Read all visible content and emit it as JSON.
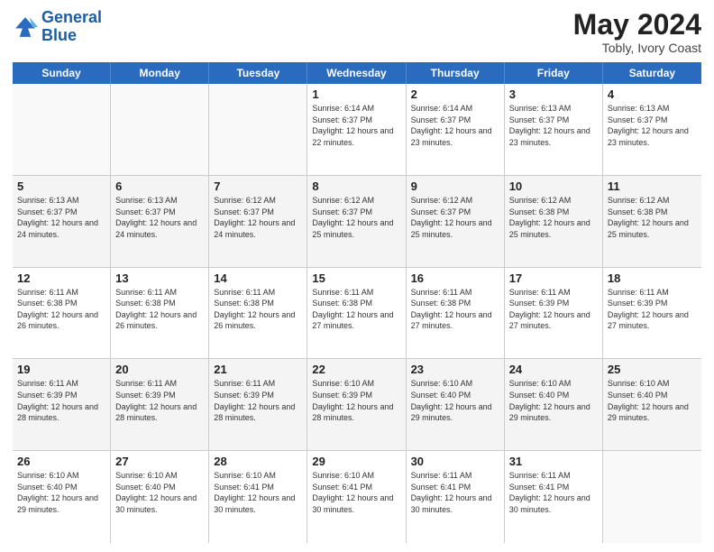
{
  "logo": {
    "text_general": "General",
    "text_blue": "Blue"
  },
  "header": {
    "month_year": "May 2024",
    "location": "Tobly, Ivory Coast"
  },
  "days_of_week": [
    "Sunday",
    "Monday",
    "Tuesday",
    "Wednesday",
    "Thursday",
    "Friday",
    "Saturday"
  ],
  "weeks": [
    [
      {
        "day": "",
        "sunrise": "",
        "sunset": "",
        "daylight": "",
        "empty": true
      },
      {
        "day": "",
        "sunrise": "",
        "sunset": "",
        "daylight": "",
        "empty": true
      },
      {
        "day": "",
        "sunrise": "",
        "sunset": "",
        "daylight": "",
        "empty": true
      },
      {
        "day": "1",
        "sunrise": "Sunrise: 6:14 AM",
        "sunset": "Sunset: 6:37 PM",
        "daylight": "Daylight: 12 hours and 22 minutes."
      },
      {
        "day": "2",
        "sunrise": "Sunrise: 6:14 AM",
        "sunset": "Sunset: 6:37 PM",
        "daylight": "Daylight: 12 hours and 23 minutes."
      },
      {
        "day": "3",
        "sunrise": "Sunrise: 6:13 AM",
        "sunset": "Sunset: 6:37 PM",
        "daylight": "Daylight: 12 hours and 23 minutes."
      },
      {
        "day": "4",
        "sunrise": "Sunrise: 6:13 AM",
        "sunset": "Sunset: 6:37 PM",
        "daylight": "Daylight: 12 hours and 23 minutes."
      }
    ],
    [
      {
        "day": "5",
        "sunrise": "Sunrise: 6:13 AM",
        "sunset": "Sunset: 6:37 PM",
        "daylight": "Daylight: 12 hours and 24 minutes."
      },
      {
        "day": "6",
        "sunrise": "Sunrise: 6:13 AM",
        "sunset": "Sunset: 6:37 PM",
        "daylight": "Daylight: 12 hours and 24 minutes."
      },
      {
        "day": "7",
        "sunrise": "Sunrise: 6:12 AM",
        "sunset": "Sunset: 6:37 PM",
        "daylight": "Daylight: 12 hours and 24 minutes."
      },
      {
        "day": "8",
        "sunrise": "Sunrise: 6:12 AM",
        "sunset": "Sunset: 6:37 PM",
        "daylight": "Daylight: 12 hours and 25 minutes."
      },
      {
        "day": "9",
        "sunrise": "Sunrise: 6:12 AM",
        "sunset": "Sunset: 6:37 PM",
        "daylight": "Daylight: 12 hours and 25 minutes."
      },
      {
        "day": "10",
        "sunrise": "Sunrise: 6:12 AM",
        "sunset": "Sunset: 6:38 PM",
        "daylight": "Daylight: 12 hours and 25 minutes."
      },
      {
        "day": "11",
        "sunrise": "Sunrise: 6:12 AM",
        "sunset": "Sunset: 6:38 PM",
        "daylight": "Daylight: 12 hours and 25 minutes."
      }
    ],
    [
      {
        "day": "12",
        "sunrise": "Sunrise: 6:11 AM",
        "sunset": "Sunset: 6:38 PM",
        "daylight": "Daylight: 12 hours and 26 minutes."
      },
      {
        "day": "13",
        "sunrise": "Sunrise: 6:11 AM",
        "sunset": "Sunset: 6:38 PM",
        "daylight": "Daylight: 12 hours and 26 minutes."
      },
      {
        "day": "14",
        "sunrise": "Sunrise: 6:11 AM",
        "sunset": "Sunset: 6:38 PM",
        "daylight": "Daylight: 12 hours and 26 minutes."
      },
      {
        "day": "15",
        "sunrise": "Sunrise: 6:11 AM",
        "sunset": "Sunset: 6:38 PM",
        "daylight": "Daylight: 12 hours and 27 minutes."
      },
      {
        "day": "16",
        "sunrise": "Sunrise: 6:11 AM",
        "sunset": "Sunset: 6:38 PM",
        "daylight": "Daylight: 12 hours and 27 minutes."
      },
      {
        "day": "17",
        "sunrise": "Sunrise: 6:11 AM",
        "sunset": "Sunset: 6:39 PM",
        "daylight": "Daylight: 12 hours and 27 minutes."
      },
      {
        "day": "18",
        "sunrise": "Sunrise: 6:11 AM",
        "sunset": "Sunset: 6:39 PM",
        "daylight": "Daylight: 12 hours and 27 minutes."
      }
    ],
    [
      {
        "day": "19",
        "sunrise": "Sunrise: 6:11 AM",
        "sunset": "Sunset: 6:39 PM",
        "daylight": "Daylight: 12 hours and 28 minutes."
      },
      {
        "day": "20",
        "sunrise": "Sunrise: 6:11 AM",
        "sunset": "Sunset: 6:39 PM",
        "daylight": "Daylight: 12 hours and 28 minutes."
      },
      {
        "day": "21",
        "sunrise": "Sunrise: 6:11 AM",
        "sunset": "Sunset: 6:39 PM",
        "daylight": "Daylight: 12 hours and 28 minutes."
      },
      {
        "day": "22",
        "sunrise": "Sunrise: 6:10 AM",
        "sunset": "Sunset: 6:39 PM",
        "daylight": "Daylight: 12 hours and 28 minutes."
      },
      {
        "day": "23",
        "sunrise": "Sunrise: 6:10 AM",
        "sunset": "Sunset: 6:40 PM",
        "daylight": "Daylight: 12 hours and 29 minutes."
      },
      {
        "day": "24",
        "sunrise": "Sunrise: 6:10 AM",
        "sunset": "Sunset: 6:40 PM",
        "daylight": "Daylight: 12 hours and 29 minutes."
      },
      {
        "day": "25",
        "sunrise": "Sunrise: 6:10 AM",
        "sunset": "Sunset: 6:40 PM",
        "daylight": "Daylight: 12 hours and 29 minutes."
      }
    ],
    [
      {
        "day": "26",
        "sunrise": "Sunrise: 6:10 AM",
        "sunset": "Sunset: 6:40 PM",
        "daylight": "Daylight: 12 hours and 29 minutes."
      },
      {
        "day": "27",
        "sunrise": "Sunrise: 6:10 AM",
        "sunset": "Sunset: 6:40 PM",
        "daylight": "Daylight: 12 hours and 30 minutes."
      },
      {
        "day": "28",
        "sunrise": "Sunrise: 6:10 AM",
        "sunset": "Sunset: 6:41 PM",
        "daylight": "Daylight: 12 hours and 30 minutes."
      },
      {
        "day": "29",
        "sunrise": "Sunrise: 6:10 AM",
        "sunset": "Sunset: 6:41 PM",
        "daylight": "Daylight: 12 hours and 30 minutes."
      },
      {
        "day": "30",
        "sunrise": "Sunrise: 6:11 AM",
        "sunset": "Sunset: 6:41 PM",
        "daylight": "Daylight: 12 hours and 30 minutes."
      },
      {
        "day": "31",
        "sunrise": "Sunrise: 6:11 AM",
        "sunset": "Sunset: 6:41 PM",
        "daylight": "Daylight: 12 hours and 30 minutes."
      },
      {
        "day": "",
        "sunrise": "",
        "sunset": "",
        "daylight": "",
        "empty": true
      }
    ]
  ]
}
